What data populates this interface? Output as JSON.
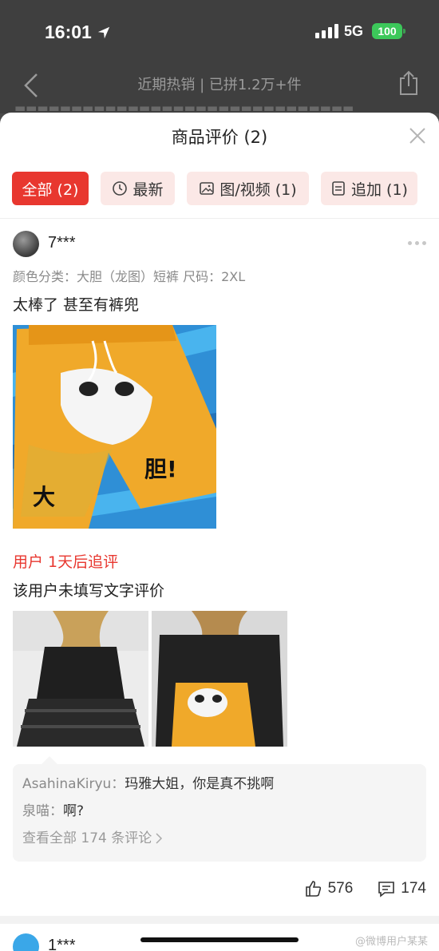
{
  "status": {
    "time": "16:01",
    "network": "5G",
    "battery": "100"
  },
  "app": {
    "title": "近期热销 | 已拼1.2万+件"
  },
  "sheet": {
    "title": "商品评价 (2)",
    "filters": [
      {
        "label": "全部 (2)",
        "icon": "",
        "active": true
      },
      {
        "label": "最新",
        "icon": "clock-icon"
      },
      {
        "label": "图/视频 (1)",
        "icon": "image-icon"
      },
      {
        "label": "追加 (1)",
        "icon": "list-icon"
      }
    ]
  },
  "review": {
    "user": "7***",
    "spec": "颜色分类：大胆（龙图）短裤    尺码：2XL",
    "text": "太棒了 甚至有裤兜",
    "image_text": "大  胆!",
    "followup_title": "用户 1天后追评",
    "followup_text": "该用户未填写文字评价",
    "comments": [
      {
        "user": "AsahinaKiryu：",
        "text": "玛雅大姐，你是真不挑啊"
      },
      {
        "user": "泉喵：",
        "text": "啊?"
      }
    ],
    "view_all": "查看全部 174 条评论",
    "likes": "576",
    "replies": "174"
  },
  "next_review": {
    "user": "1***"
  },
  "watermark": "@微博用户某某"
}
